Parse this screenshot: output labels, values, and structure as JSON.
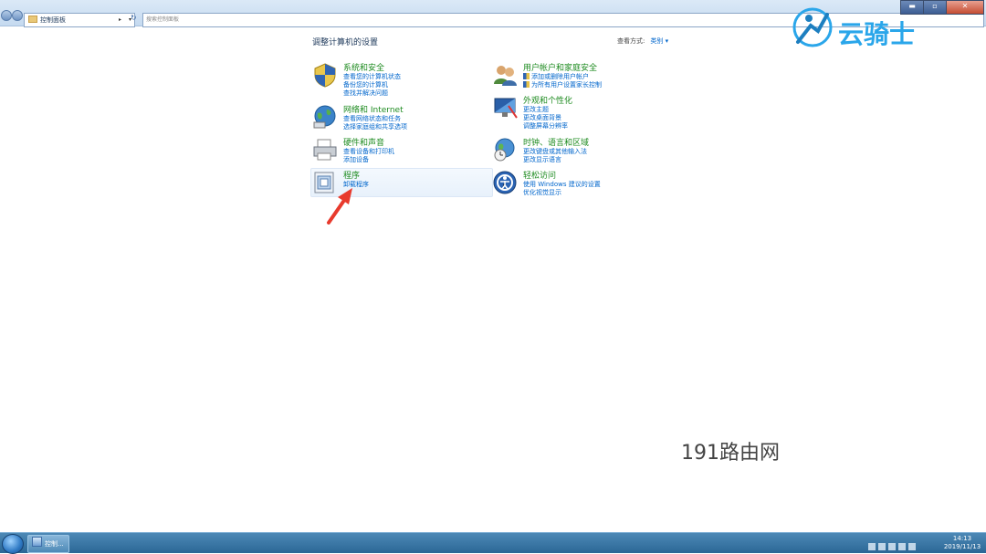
{
  "address": {
    "breadcrumb": "控制面板",
    "separator": "▸"
  },
  "search": {
    "placeholder": "搜索控制面板"
  },
  "window": {
    "min": "▬",
    "max": "▫",
    "close": "✕"
  },
  "main": {
    "heading": "调整计算机的设置",
    "view_by_label": "查看方式:",
    "view_by_value": "类别 ▾"
  },
  "categories": [
    {
      "title": "系统和安全",
      "links": [
        "查看您的计算机状态",
        "备份您的计算机",
        "查找并解决问题"
      ]
    },
    {
      "title": "网络和 Internet",
      "links": [
        "查看网络状态和任务",
        "选择家庭组和共享选项"
      ]
    },
    {
      "title": "硬件和声音",
      "links": [
        "查看设备和打印机",
        "添加设备"
      ]
    },
    {
      "title": "程序",
      "links": [
        "卸载程序"
      ]
    },
    {
      "title": "用户帐户和家庭安全",
      "links": [
        "添加或删除用户帐户",
        "为所有用户设置家长控制"
      ]
    },
    {
      "title": "外观和个性化",
      "links": [
        "更改主题",
        "更改桌面背景",
        "调整屏幕分辨率"
      ]
    },
    {
      "title": "时钟、语言和区域",
      "links": [
        "更改键盘或其他输入法",
        "更改显示语言"
      ]
    },
    {
      "title": "轻松访问",
      "links": [
        "使用 Windows 建议的设置",
        "优化视觉显示"
      ]
    }
  ],
  "watermarks": {
    "brand": "云骑士",
    "site": "191路由网"
  },
  "taskbar": {
    "task_label": "控制...",
    "time": "14:13",
    "date": "2019/11/13"
  },
  "colors": {
    "link": "#0066cc",
    "category_title": "#1e8b20",
    "taskbar": "#2b6796"
  }
}
